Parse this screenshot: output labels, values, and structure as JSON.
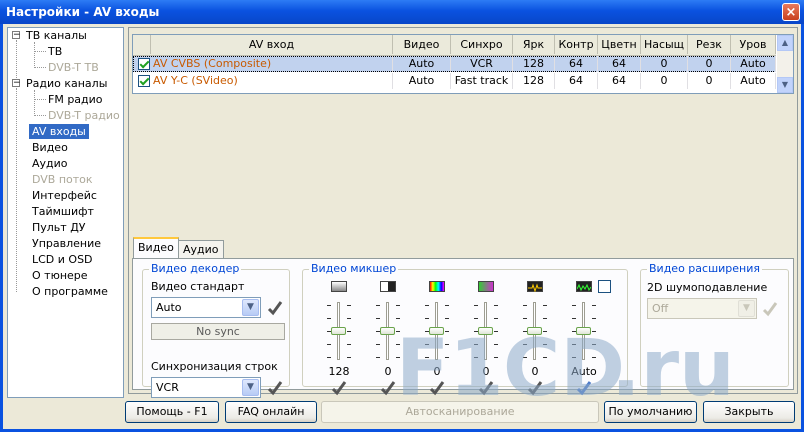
{
  "window": {
    "title": "Настройки - AV входы",
    "close_label": "×"
  },
  "tree": {
    "items": [
      {
        "label": "ТВ каналы"
      },
      {
        "label": "ТВ"
      },
      {
        "label": "DVB-T ТВ"
      },
      {
        "label": "Радио каналы"
      },
      {
        "label": "FM радио"
      },
      {
        "label": "DVB-T радио"
      },
      {
        "label": "AV входы"
      },
      {
        "label": "Видео"
      },
      {
        "label": "Аудио"
      },
      {
        "label": "DVB поток"
      },
      {
        "label": "Интерфейс"
      },
      {
        "label": "Таймшифт"
      },
      {
        "label": "Пульт ДУ"
      },
      {
        "label": "Управление"
      },
      {
        "label": "LCD и OSD"
      },
      {
        "label": "О тюнере"
      },
      {
        "label": "О программе"
      }
    ],
    "expand_sign": "−"
  },
  "grid": {
    "columns": [
      "AV вход",
      "Видео",
      "Синхро",
      "Ярк",
      "Контр",
      "Цветн",
      "Насыщ",
      "Резк",
      "Уров"
    ],
    "rows": [
      {
        "name": "AV CVBS (Composite)",
        "video": "Auto",
        "sync": "VCR",
        "bright": "128",
        "contrast": "64",
        "color": "64",
        "saturation": "0",
        "sharp": "0",
        "level": "Auto"
      },
      {
        "name": "AV Y-C (SVideo)",
        "video": "Auto",
        "sync": "Fast track",
        "bright": "128",
        "contrast": "64",
        "color": "64",
        "saturation": "0",
        "sharp": "0",
        "level": "Auto"
      }
    ]
  },
  "tabs": {
    "video": "Видео",
    "audio": "Аудио"
  },
  "decoder": {
    "group_title": "Видео декодер",
    "standard_label": "Видео стандарт",
    "standard_value": "Auto",
    "status": "No sync",
    "sync_label": "Синхронизация строк",
    "sync_value": "VCR"
  },
  "mixer": {
    "group_title": "Видео микшер",
    "channels": [
      {
        "value": "128",
        "level": 0.5
      },
      {
        "value": "0",
        "level": 0.5
      },
      {
        "value": "0",
        "level": 0.5
      },
      {
        "value": "0",
        "level": 0.5
      },
      {
        "value": "0",
        "level": 0.5
      },
      {
        "value": "Auto",
        "level": 0.5
      }
    ]
  },
  "extensions": {
    "group_title": "Видео расширения",
    "noise_label": "2D шумоподавление",
    "noise_value": "Off"
  },
  "buttons": {
    "help": "Помощь - F1",
    "faq": "FAQ онлайн",
    "autoscan": "Автосканирование",
    "defaults": "По умолчанию",
    "close": "Закрыть"
  },
  "watermark": {
    "f1": "F1",
    "cd": "CD",
    "ru": ".ru"
  },
  "colors": {
    "accent": "#0a52e0",
    "group_title": "#0046d5",
    "input_name": "#c85a00",
    "selection": "#316ac5"
  }
}
